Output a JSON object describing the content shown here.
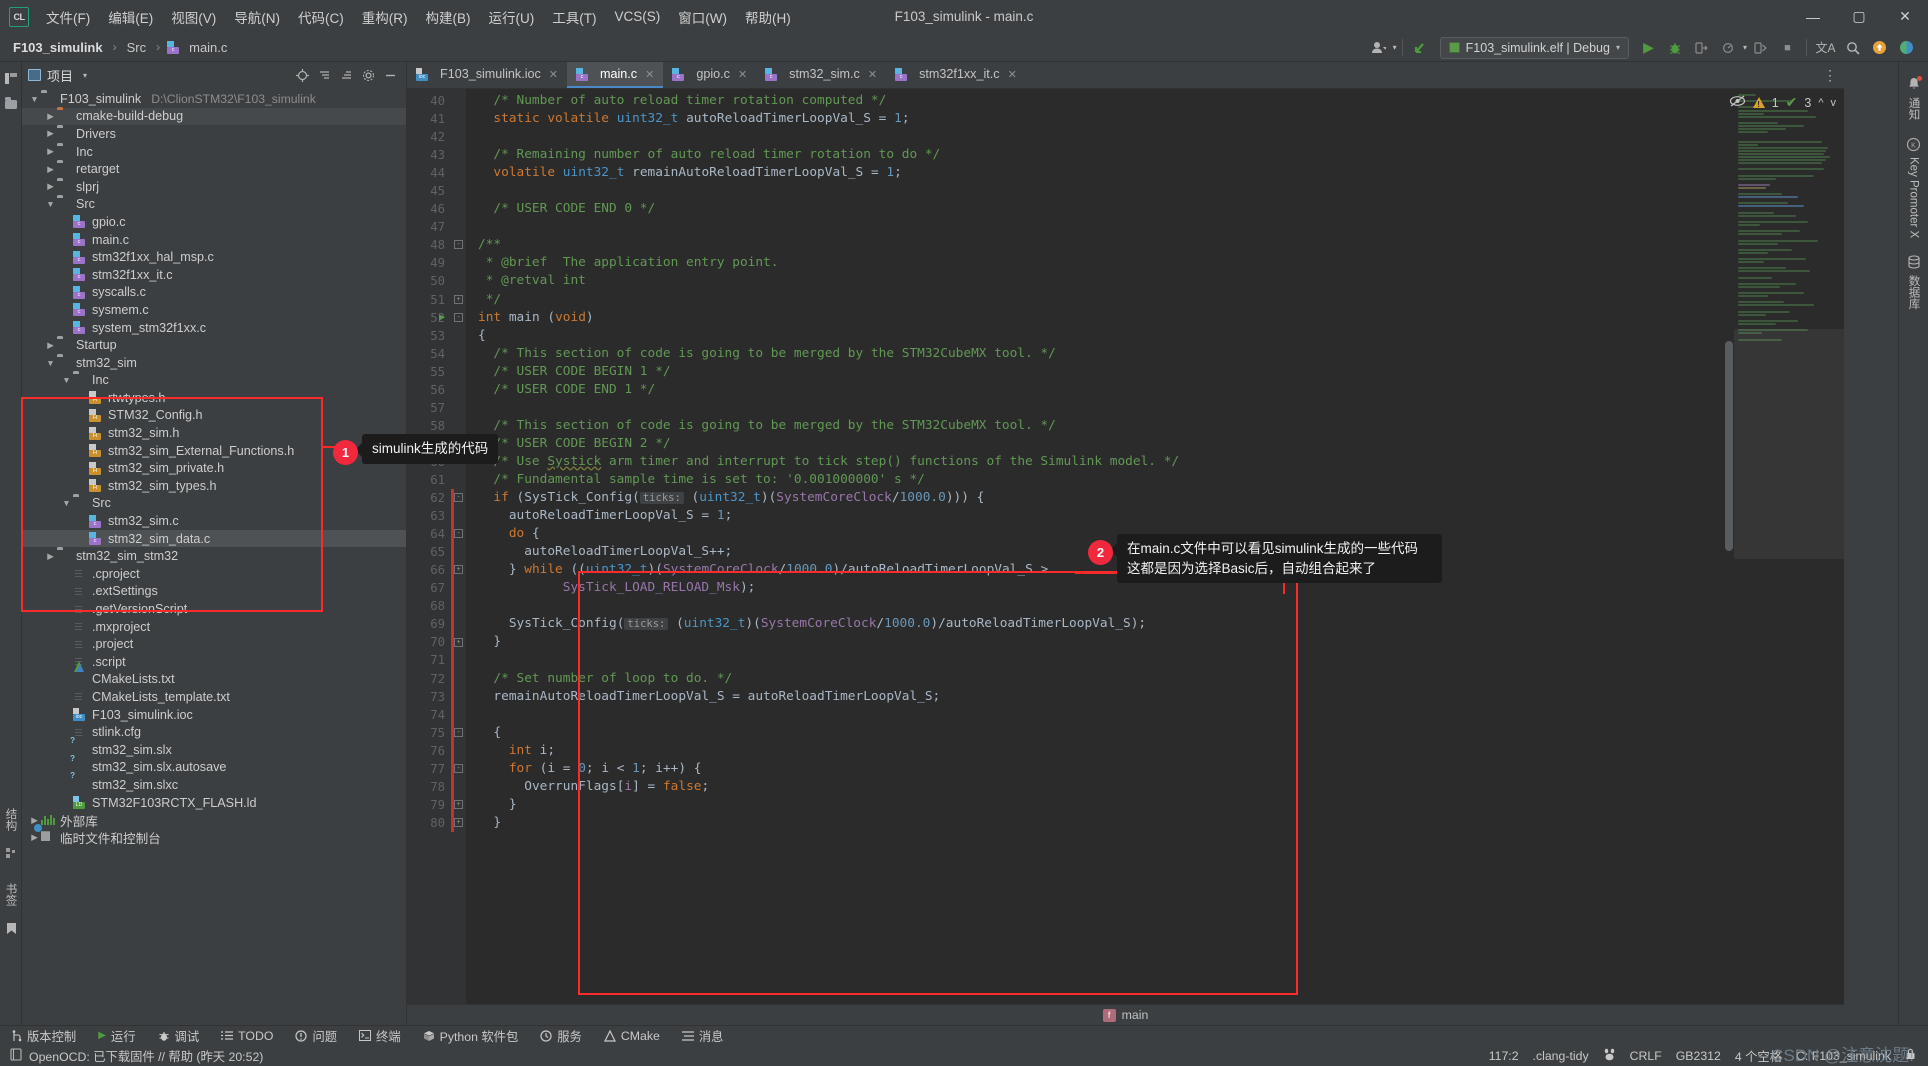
{
  "window": {
    "title": "F103_simulink - main.c",
    "logo": "CL",
    "menus": [
      "文件(F)",
      "编辑(E)",
      "视图(V)",
      "导航(N)",
      "代码(C)",
      "重构(R)",
      "构建(B)",
      "运行(U)",
      "工具(T)",
      "VCS(S)",
      "窗口(W)",
      "帮助(H)"
    ],
    "controls": {
      "minimize": "—",
      "maximize": "▢",
      "close": "✕"
    }
  },
  "breadcrumb": {
    "project": "F103_simulink",
    "folder": "Src",
    "file": "main.c",
    "sep": "›"
  },
  "toolbar": {
    "user_icon": "user-icon",
    "vcs_update_icon": "vcs-update-icon",
    "run_config": "F103_simulink.elf | Debug",
    "run_icon": "▶",
    "debug_icon": "debug-bug-icon",
    "step_icon": "step-over-icon",
    "profile_icon": "profile-icon",
    "attach_icon": "attach-icon",
    "stop_icon": "■",
    "translate_icon": "文A",
    "search_icon": "search-icon",
    "update_icon": "update-icon",
    "plugin_icon": "plugin-icon"
  },
  "left_strip": {
    "project_tab": "项目",
    "structure_tab": "结构",
    "bookmark_tab": "书签",
    "icons": [
      "project-icon",
      "commit-icon",
      "bookmark-icon"
    ]
  },
  "project_panel": {
    "title": "项目",
    "header_icons": [
      "locate-icon",
      "collapse-all-icon",
      "expand-all-icon",
      "settings-gear-icon",
      "hide-icon"
    ],
    "tree": [
      {
        "depth": 0,
        "arrow": "v",
        "icon": "folder",
        "label": "F103_simulink",
        "note": "D:\\ClionSTM32\\F103_simulink"
      },
      {
        "depth": 1,
        "arrow": ">",
        "icon": "folder-orange",
        "label": "cmake-build-debug",
        "state": "hl"
      },
      {
        "depth": 1,
        "arrow": ">",
        "icon": "folder",
        "label": "Drivers"
      },
      {
        "depth": 1,
        "arrow": ">",
        "icon": "folder",
        "label": "Inc"
      },
      {
        "depth": 1,
        "arrow": ">",
        "icon": "folder",
        "label": "retarget"
      },
      {
        "depth": 1,
        "arrow": ">",
        "icon": "folder",
        "label": "slprj"
      },
      {
        "depth": 1,
        "arrow": "v",
        "icon": "folder",
        "label": "Src"
      },
      {
        "depth": 2,
        "arrow": "",
        "icon": "c",
        "label": "gpio.c"
      },
      {
        "depth": 2,
        "arrow": "",
        "icon": "c",
        "label": "main.c"
      },
      {
        "depth": 2,
        "arrow": "",
        "icon": "c",
        "label": "stm32f1xx_hal_msp.c"
      },
      {
        "depth": 2,
        "arrow": "",
        "icon": "c",
        "label": "stm32f1xx_it.c"
      },
      {
        "depth": 2,
        "arrow": "",
        "icon": "c",
        "label": "syscalls.c"
      },
      {
        "depth": 2,
        "arrow": "",
        "icon": "c",
        "label": "sysmem.c"
      },
      {
        "depth": 2,
        "arrow": "",
        "icon": "c",
        "label": "system_stm32f1xx.c"
      },
      {
        "depth": 1,
        "arrow": ">",
        "icon": "folder",
        "label": "Startup"
      },
      {
        "depth": 1,
        "arrow": "v",
        "icon": "folder",
        "label": "stm32_sim"
      },
      {
        "depth": 2,
        "arrow": "v",
        "icon": "folder",
        "label": "Inc"
      },
      {
        "depth": 3,
        "arrow": "",
        "icon": "h",
        "label": "rtwtypes.h"
      },
      {
        "depth": 3,
        "arrow": "",
        "icon": "h",
        "label": "STM32_Config.h"
      },
      {
        "depth": 3,
        "arrow": "",
        "icon": "h",
        "label": "stm32_sim.h"
      },
      {
        "depth": 3,
        "arrow": "",
        "icon": "h",
        "label": "stm32_sim_External_Functions.h"
      },
      {
        "depth": 3,
        "arrow": "",
        "icon": "h",
        "label": "stm32_sim_private.h"
      },
      {
        "depth": 3,
        "arrow": "",
        "icon": "h",
        "label": "stm32_sim_types.h"
      },
      {
        "depth": 2,
        "arrow": "v",
        "icon": "folder",
        "label": "Src"
      },
      {
        "depth": 3,
        "arrow": "",
        "icon": "c",
        "label": "stm32_sim.c"
      },
      {
        "depth": 3,
        "arrow": "",
        "icon": "c",
        "label": "stm32_sim_data.c",
        "state": "sel"
      },
      {
        "depth": 1,
        "arrow": ">",
        "icon": "folder",
        "label": "stm32_sim_stm32"
      },
      {
        "depth": 2,
        "arrow": "",
        "icon": "doc",
        "label": ".cproject"
      },
      {
        "depth": 2,
        "arrow": "",
        "icon": "doc",
        "label": ".extSettings"
      },
      {
        "depth": 2,
        "arrow": "",
        "icon": "doc",
        "label": ".getVersionScript"
      },
      {
        "depth": 2,
        "arrow": "",
        "icon": "doc",
        "label": ".mxproject"
      },
      {
        "depth": 2,
        "arrow": "",
        "icon": "doc",
        "label": ".project"
      },
      {
        "depth": 2,
        "arrow": "",
        "icon": "doc",
        "label": ".script"
      },
      {
        "depth": 2,
        "arrow": "",
        "icon": "cmake",
        "label": "CMakeLists.txt"
      },
      {
        "depth": 2,
        "arrow": "",
        "icon": "doc",
        "label": "CMakeLists_template.txt"
      },
      {
        "depth": 2,
        "arrow": "",
        "icon": "ioc",
        "label": "F103_simulink.ioc"
      },
      {
        "depth": 2,
        "arrow": "",
        "icon": "doc",
        "label": "stlink.cfg"
      },
      {
        "depth": 2,
        "arrow": "",
        "icon": "slx",
        "label": "stm32_sim.slx"
      },
      {
        "depth": 2,
        "arrow": "",
        "icon": "slx",
        "label": "stm32_sim.slx.autosave"
      },
      {
        "depth": 2,
        "arrow": "",
        "icon": "slx",
        "label": "stm32_sim.slxc"
      },
      {
        "depth": 2,
        "arrow": "",
        "icon": "ld",
        "label": "STM32F103RCTX_FLASH.ld"
      },
      {
        "depth": 0,
        "arrow": ">",
        "icon": "libs",
        "label": "外部库"
      },
      {
        "depth": 0,
        "arrow": ">",
        "icon": "scratch",
        "label": "临时文件和控制台"
      }
    ]
  },
  "editor": {
    "tabs": [
      {
        "label": "F103_simulink.ioc",
        "icon": "ioc",
        "active": false
      },
      {
        "label": "main.c",
        "icon": "c",
        "active": true
      },
      {
        "label": "gpio.c",
        "icon": "c",
        "active": false
      },
      {
        "label": "stm32_sim.c",
        "icon": "c",
        "active": false
      },
      {
        "label": "stm32f1xx_it.c",
        "icon": "c",
        "active": false
      }
    ],
    "inspection": {
      "eye_icon": "inspection-off-icon",
      "warning_count": "1",
      "check_count": "3",
      "prev_icon": "^",
      "next_icon": "v"
    },
    "first_line_number": 40,
    "lines": [
      {
        "n": 40,
        "html": "<span class='cmt'>  /* Number of auto reload timer rotation computed */</span>"
      },
      {
        "n": 41,
        "html": "  <span class='kw'>static volatile</span> <span class='typ'>uint32_t</span> autoReloadTimerLoopVal_S = <span class='num'>1</span>;"
      },
      {
        "n": 42,
        "html": ""
      },
      {
        "n": 43,
        "html": "<span class='cmt'>  /* Remaining number of auto reload timer rotation to do */</span>"
      },
      {
        "n": 44,
        "html": "  <span class='kw'>volatile</span> <span class='typ'>uint32_t</span> remainAutoReloadTimerLoopVal_S = <span class='num'>1</span>;"
      },
      {
        "n": 45,
        "html": ""
      },
      {
        "n": 46,
        "html": "<span class='cmt'>  /* USER CODE END 0 */</span>"
      },
      {
        "n": 47,
        "html": ""
      },
      {
        "n": 48,
        "html": "<span class='cmt'>/**</span>"
      },
      {
        "n": 49,
        "html": "<span class='cmt'> * @brief  The application entry point.</span>"
      },
      {
        "n": 50,
        "html": "<span class='cmt'> * @retval int</span>"
      },
      {
        "n": 51,
        "html": "<span class='cmt'> */</span>"
      },
      {
        "n": 52,
        "html": "<span class='kw'>int</span> <span class='id'>main</span> (<span class='kw'>void</span>)"
      },
      {
        "n": 53,
        "html": "{"
      },
      {
        "n": 54,
        "html": "<span class='cmt'>  /* This section of code is going to be merged by the STM32CubeMX tool. */</span>"
      },
      {
        "n": 55,
        "html": "<span class='cmt'>  /* USER CODE BEGIN 1 */</span>"
      },
      {
        "n": 56,
        "html": "<span class='cmt'>  /* USER CODE END 1 */</span>"
      },
      {
        "n": 57,
        "html": ""
      },
      {
        "n": 58,
        "html": "<span class='cmt'>  /* This section of code is going to be merged by the STM32CubeMX tool. */</span>"
      },
      {
        "n": 59,
        "html": "<span class='cmt'>  /* USER CODE BEGIN 2 */</span>"
      },
      {
        "n": 60,
        "html": "<span class='cmt'>  /* Use <span class='wave'>Systick</span> arm timer and interrupt to tick step() functions of the Simulink model. */</span>"
      },
      {
        "n": 61,
        "html": "<span class='cmt'>  /* Fundamental sample time is set to: '0.001000000' s */</span>"
      },
      {
        "n": 62,
        "html": "  <span class='kw'>if</span> (<span class='id'>SysTick_Config</span>(<span class='hint'>ticks:</span> (<span class='typ'>uint32_t</span>)(<span class='purp'>SystemCoreClock</span>/<span class='num'>1000.0</span>))) {"
      },
      {
        "n": 63,
        "html": "    autoReloadTimerLoopVal_S = <span class='num'>1</span>;"
      },
      {
        "n": 64,
        "html": "    <span class='kw'>do</span> {"
      },
      {
        "n": 65,
        "html": "      autoReloadTimerLoopVal_S++;"
      },
      {
        "n": 66,
        "html": "    } <span class='kw'>while</span> ((<span class='typ'>uint32_t</span>)(<span class='purp'>SystemCoreClock</span>/<span class='num'>1000.0</span>)/autoReloadTimerLoopVal_S &gt;"
      },
      {
        "n": 67,
        "html": "           <span class='purp'>SysTick_LOAD_RELOAD_Msk</span>);"
      },
      {
        "n": 68,
        "html": ""
      },
      {
        "n": 69,
        "html": "    <span class='id'>SysTick_Config</span>(<span class='hint'>ticks:</span> (<span class='typ'>uint32_t</span>)(<span class='purp'>SystemCoreClock</span>/<span class='num'>1000.0</span>)/autoReloadTimerLoopVal_S);"
      },
      {
        "n": 70,
        "html": "  }"
      },
      {
        "n": 71,
        "html": ""
      },
      {
        "n": 72,
        "html": "<span class='cmt'>  /* Set number of loop to do. */</span>"
      },
      {
        "n": 73,
        "html": "  remainAutoReloadTimerLoopVal_S = autoReloadTimerLoopVal_S;"
      },
      {
        "n": 74,
        "html": ""
      },
      {
        "n": 75,
        "html": "  {"
      },
      {
        "n": 76,
        "html": "    <span class='kw'>int</span> i;"
      },
      {
        "n": 77,
        "html": "    <span class='kw'>for</span> (i = <span class='num'>0</span>; i &lt; <span class='num'>1</span>; i++) {"
      },
      {
        "n": 78,
        "html": "      <span class='id'>OverrunFlags</span>[<span class='purp'>i</span>] = <span class='kw'>false</span>;"
      },
      {
        "n": 79,
        "html": "    }"
      },
      {
        "n": 80,
        "html": "  }"
      }
    ],
    "crumb": {
      "icon": "function-icon",
      "label": "main"
    }
  },
  "right_strip": {
    "items": [
      {
        "icon": "notification-bell-icon",
        "label": "通知",
        "badge": true
      },
      {
        "icon": "key-promoter-icon",
        "label": "Key Promoter X",
        "badge": false
      },
      {
        "icon": "database-icon",
        "label": "数据库",
        "badge": false
      }
    ]
  },
  "tool_windows": [
    {
      "icon": "vcs-branch-icon",
      "label": "版本控制"
    },
    {
      "icon": "run-icon",
      "label": "运行"
    },
    {
      "icon": "debug-icon",
      "label": "调试"
    },
    {
      "icon": "todo-icon",
      "label": "TODO"
    },
    {
      "icon": "problems-icon",
      "label": "问题"
    },
    {
      "icon": "terminal-icon",
      "label": "终端"
    },
    {
      "icon": "python-icon",
      "label": "Python 软件包"
    },
    {
      "icon": "services-icon",
      "label": "服务"
    },
    {
      "icon": "cmake-icon",
      "label": "CMake"
    },
    {
      "icon": "messages-icon",
      "label": "消息"
    }
  ],
  "status_bar": {
    "left_icon": "event-log-icon",
    "message": "OpenOCD: 已下载固件 // 帮助 (昨天 20:52)",
    "caret": "117:2",
    "inspection_profile": ".clang-tidy",
    "baidu_icon": "baidu-icon",
    "line_separator": "CRLF",
    "encoding": "GB2312",
    "indent": "4 个空格",
    "branch": "C: F103_simulink",
    "lock_icon": "lock-icon"
  },
  "annotations": [
    {
      "number": "1",
      "text": "simulink生成的代码"
    },
    {
      "number": "2",
      "text": "在main.c文件中可以看见simulink生成的一些代码\n这都是因为选择Basic后，自动组合起来了"
    }
  ],
  "watermark": "CSDN @注意沈题!",
  "colors": {
    "accent_blue": "#4a88c7",
    "annotation_red": "#fc2b2b",
    "badge_red": "#f2293c",
    "editor_bg": "#2b2b2b",
    "panel_bg": "#3c3f41",
    "comment_green": "#629755",
    "keyword_orange": "#cc7832"
  }
}
